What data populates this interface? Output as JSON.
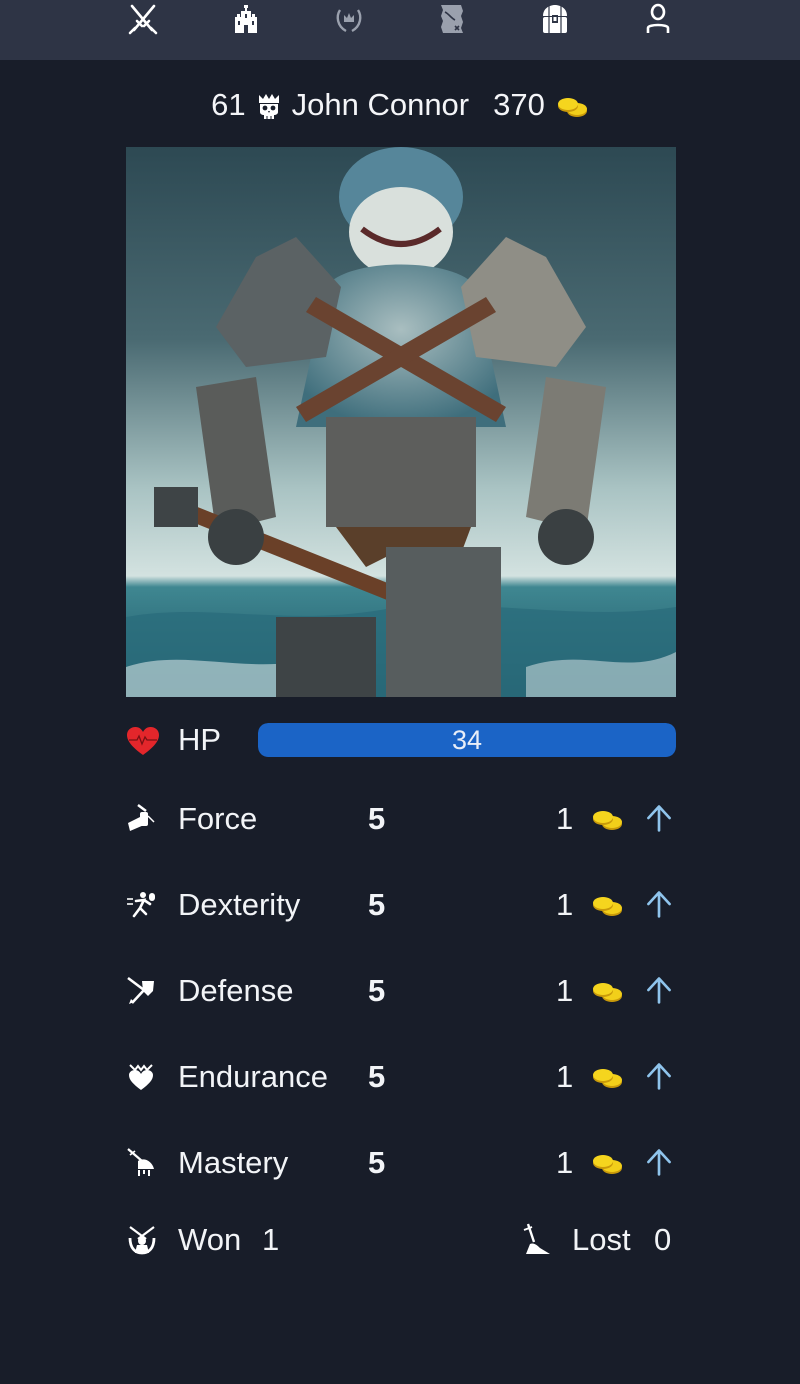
{
  "nav": {
    "items": [
      {
        "name": "battle",
        "icon": "crossed-swords-icon",
        "color": "#ffffff"
      },
      {
        "name": "castle",
        "icon": "castle-icon",
        "color": "#ffffff"
      },
      {
        "name": "rankings",
        "icon": "laurel-crown-icon",
        "color": "#9aa0ad"
      },
      {
        "name": "map",
        "icon": "treasure-map-icon",
        "color": "#9aa0ad"
      },
      {
        "name": "inventory",
        "icon": "treasure-chest-icon",
        "color": "#ffffff"
      },
      {
        "name": "profile",
        "icon": "user-icon",
        "color": "#ffffff"
      }
    ]
  },
  "player": {
    "level": "61",
    "level_icon": "crowned-skull-icon",
    "name": "John Connor",
    "gold": "370",
    "gold_icon": "gold-coins-icon"
  },
  "portrait": {
    "alt": "Armored shark warrior holding a hammer in stormy sea"
  },
  "hp": {
    "label": "HP",
    "value": "34",
    "fill_fraction": 1.0,
    "bar_color": "#1b64c6",
    "icon": "heartbeat-icon",
    "icon_color": "#e3262b"
  },
  "stats": [
    {
      "name": "Force",
      "value": "5",
      "cost": "1",
      "icon": "fist-icon"
    },
    {
      "name": "Dexterity",
      "value": "5",
      "cost": "1",
      "icon": "running-icon"
    },
    {
      "name": "Defense",
      "value": "5",
      "cost": "1",
      "icon": "shield-arrow-icon"
    },
    {
      "name": "Endurance",
      "value": "5",
      "cost": "1",
      "icon": "heart-crown-icon"
    },
    {
      "name": "Mastery",
      "value": "5",
      "cost": "1",
      "icon": "sword-slash-icon"
    }
  ],
  "upgrade_icon": "arrow-up-icon",
  "upgrade_color": "#8fc4ec",
  "coin_color": "#f2cf1a",
  "results": {
    "won_label": "Won",
    "won_value": "1",
    "lost_label": "Lost",
    "lost_value": "0"
  }
}
